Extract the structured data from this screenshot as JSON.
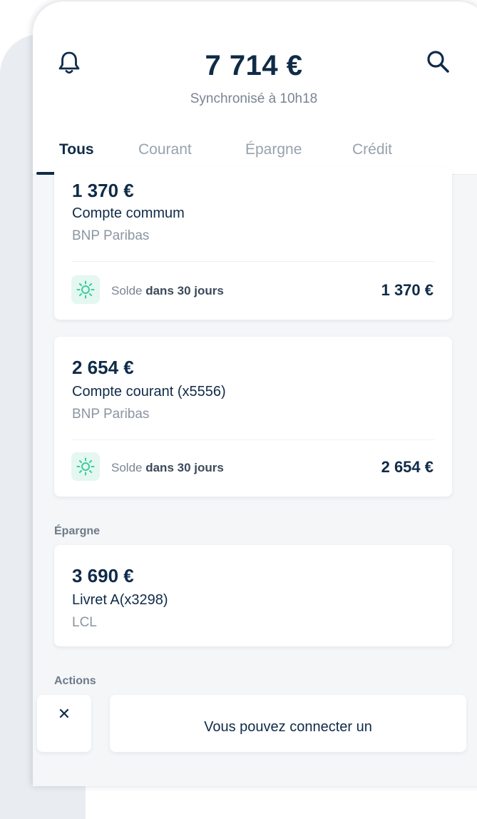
{
  "header": {
    "total_balance": "7 714 €",
    "sync_status": "Synchronisé à 10h18"
  },
  "tabs": [
    {
      "label": "Tous",
      "active": true
    },
    {
      "label": "Courant",
      "active": false
    },
    {
      "label": "Épargne",
      "active": false
    },
    {
      "label": "Crédit",
      "active": false
    }
  ],
  "accounts": [
    {
      "amount": "1 370 €",
      "name": "Compte commum",
      "bank": "BNP Paribas",
      "forecast_prefix": "Solde",
      "forecast_period": "dans 30 jours",
      "forecast_amount": "1 370 €"
    },
    {
      "amount": "2 654 €",
      "name": "Compte courant (x5556)",
      "bank": "BNP Paribas",
      "forecast_prefix": "Solde",
      "forecast_period": "dans 30 jours",
      "forecast_amount": "2 654 €"
    }
  ],
  "savings_section": {
    "label": "Épargne",
    "account": {
      "amount": "3 690 €",
      "name": "Livret A(x3298)",
      "bank": "LCL"
    }
  },
  "actions_section": {
    "label": "Actions",
    "close_symbol": "✕",
    "promo_text": "Vous pouvez connecter un"
  },
  "icons": {
    "bell": "bell-icon",
    "search": "search-icon",
    "forecast": "sun-icon",
    "close": "close-icon"
  },
  "colors": {
    "primary_text": "#0f2b48",
    "muted_text": "#7a8593",
    "accent_green": "#3ccc9b",
    "accent_green_bg": "#e4f7f1",
    "background": "#f4f6f8"
  }
}
